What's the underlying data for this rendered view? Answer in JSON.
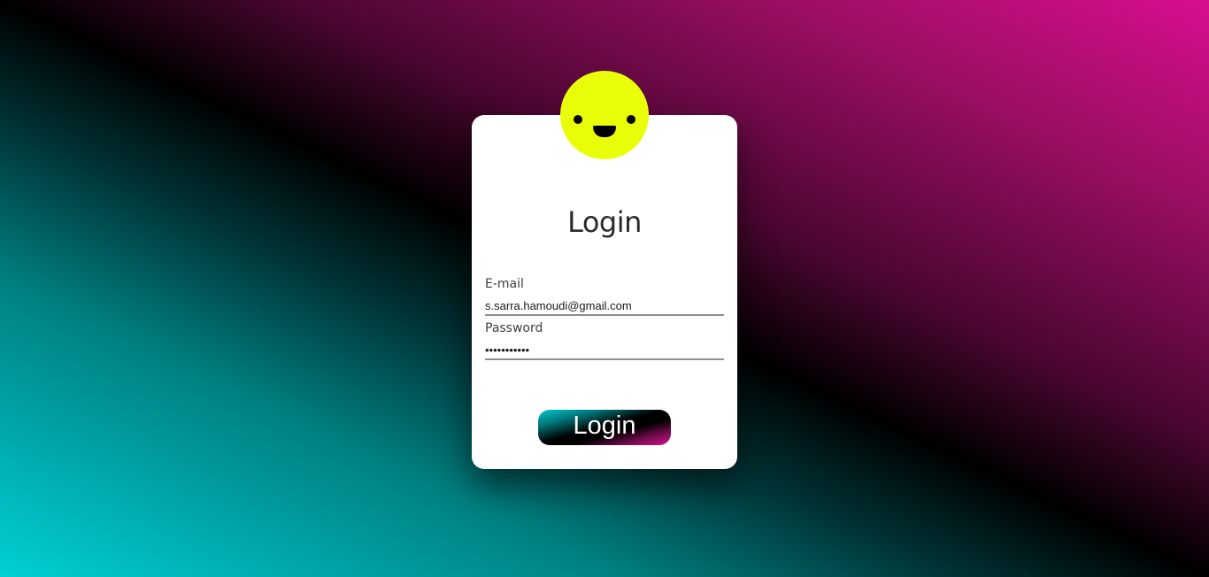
{
  "login_form": {
    "title": "Login",
    "email": {
      "label": "E-mail",
      "value": "s.sarra.hamoudi@gmail.com"
    },
    "password": {
      "label": "Password",
      "value": "•••••••••••"
    },
    "submit_label": "Login"
  },
  "icons": {
    "avatar": "smiley-face-icon"
  },
  "colors": {
    "avatar": "#e9ff0a",
    "gradient_cyan": "#00d0d4",
    "gradient_black": "#000000",
    "gradient_magenta": "#d80e8e",
    "card": "#ffffff"
  }
}
